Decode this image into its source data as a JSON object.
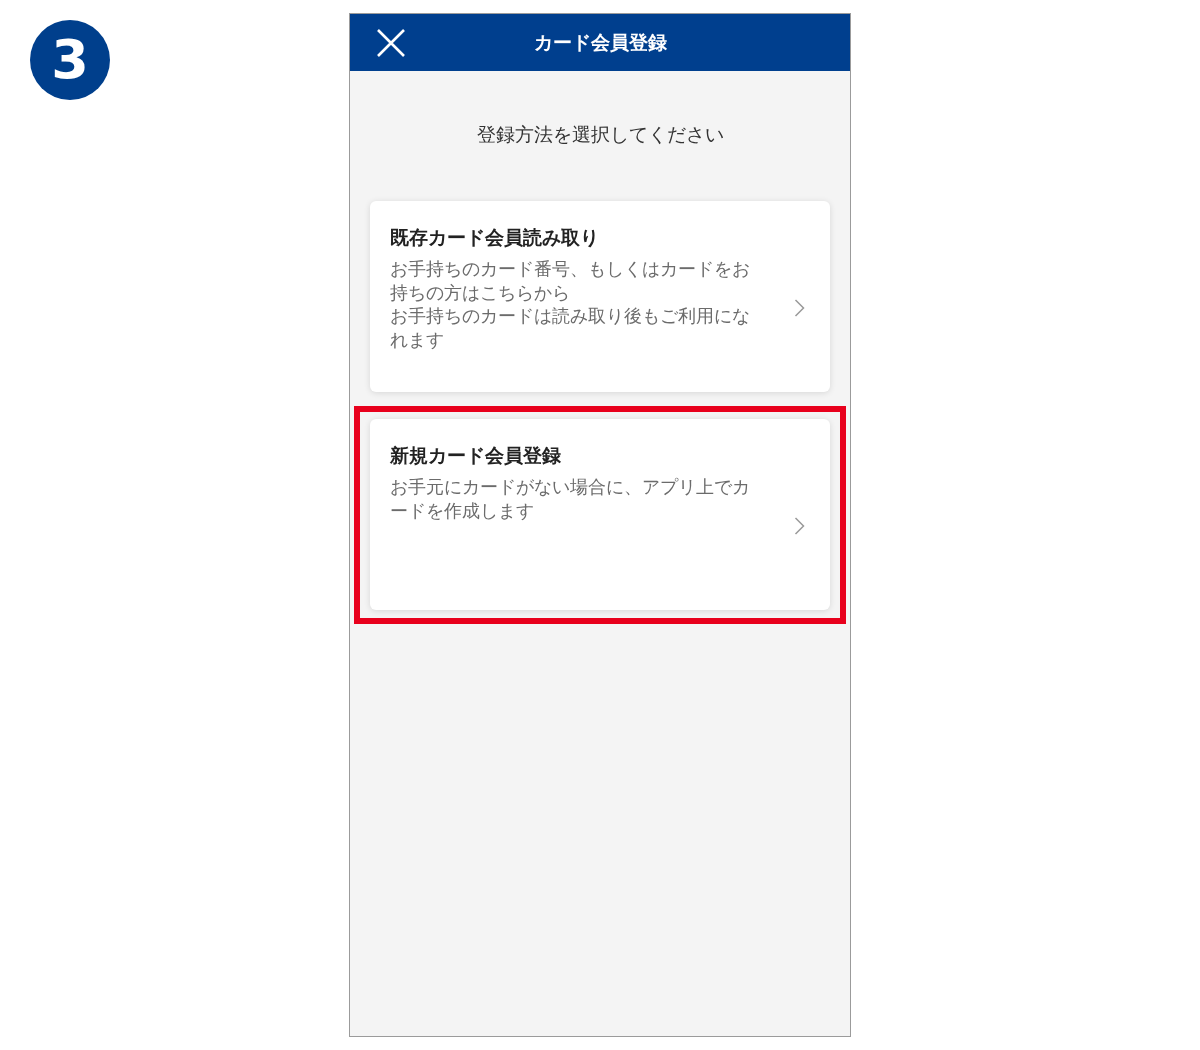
{
  "step_badge": "3",
  "header": {
    "title": "カード会員登録"
  },
  "prompt": "登録方法を選択してください",
  "cards": [
    {
      "title": "既存カード会員読み取り",
      "description": [
        "お手持ちのカード番号、もしくはカードをお持ちの方はこちらから",
        "お手持ちのカードは読み取り後もご利用になれます"
      ],
      "highlighted": false
    },
    {
      "title": "新規カード会員登録",
      "description": [
        "お手元にカードがない場合に、アプリ上でカードを作成します"
      ],
      "highlighted": true
    }
  ]
}
